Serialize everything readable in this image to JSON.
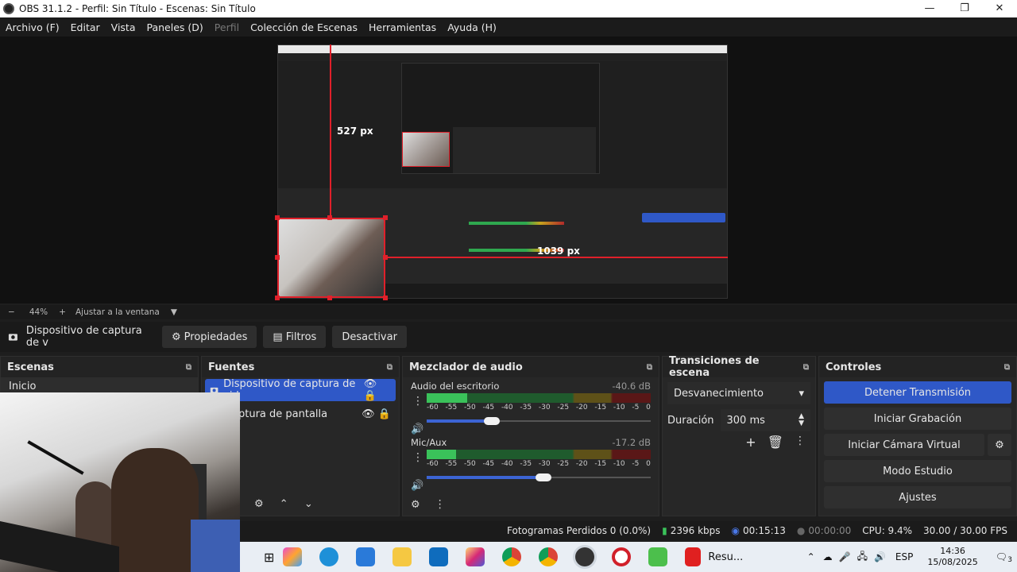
{
  "window": {
    "title": "OBS 31.1.2 - Perfil: Sin Título - Escenas: Sin Título",
    "minimize": "—",
    "restore": "❐",
    "close": "✕"
  },
  "menu": {
    "items": [
      "Archivo (F)",
      "Editar",
      "Vista",
      "Paneles (D)",
      "Perfil",
      "Colección de Escenas",
      "Herramientas",
      "Ayuda (H)"
    ]
  },
  "preview": {
    "measure_vertical": "527 px",
    "measure_horizontal": "1039 px"
  },
  "zoom": {
    "minus": "−",
    "level": "44%",
    "plus": "+",
    "fit": "Ajustar a la ventana",
    "dropdown": "▼"
  },
  "source_toolbar": {
    "source_name": "Dispositivo de captura de v",
    "properties": "Propiedades",
    "filters": "Filtros",
    "deactivate": "Desactivar"
  },
  "scenes": {
    "title": "Escenas",
    "items": [
      "Inicio"
    ]
  },
  "sources": {
    "title": "Fuentes",
    "items": [
      "Dispositivo de captura de vid",
      "ptura de pantalla"
    ]
  },
  "mixer": {
    "title": "Mezclador de audio",
    "ticks": [
      "-60",
      "-55",
      "-50",
      "-45",
      "-40",
      "-35",
      "-30",
      "-25",
      "-20",
      "-15",
      "-10",
      "-5",
      "0"
    ],
    "channels": [
      {
        "name": "Audio del escritorio",
        "db": "-40.6 dB",
        "level": 0.18,
        "volume": 0.29
      },
      {
        "name": "Mic/Aux",
        "db": "-17.2 dB",
        "level": 0.13,
        "volume": 0.52
      }
    ]
  },
  "transitions": {
    "title": "Transiciones de escena",
    "selected": "Desvanecimiento",
    "duration_label": "Duración",
    "duration_value": "300 ms"
  },
  "controls": {
    "title": "Controles",
    "stop_stream": "Detener Transmisión",
    "start_recording": "Iniciar Grabación",
    "virtual_camera": "Iniciar Cámara Virtual",
    "studio_mode": "Modo Estudio",
    "settings": "Ajustes"
  },
  "status": {
    "dropped_frames": "Fotogramas Perdidos 0 (0.0%)",
    "bitrate": "2396 kbps",
    "stream_time": "00:15:13",
    "rec_time": "00:00:00",
    "cpu": "CPU: 9.4%",
    "fps": "30.00 / 30.00 FPS"
  },
  "taskbar": {
    "active_app": "Resu...",
    "language": "ESP",
    "time": "14:36",
    "date": "15/08/2025",
    "notifications": "3"
  },
  "colors": {
    "accent": "#2f58c7",
    "red_guide": "#e0202a",
    "meter_green": "#3ac25a"
  }
}
